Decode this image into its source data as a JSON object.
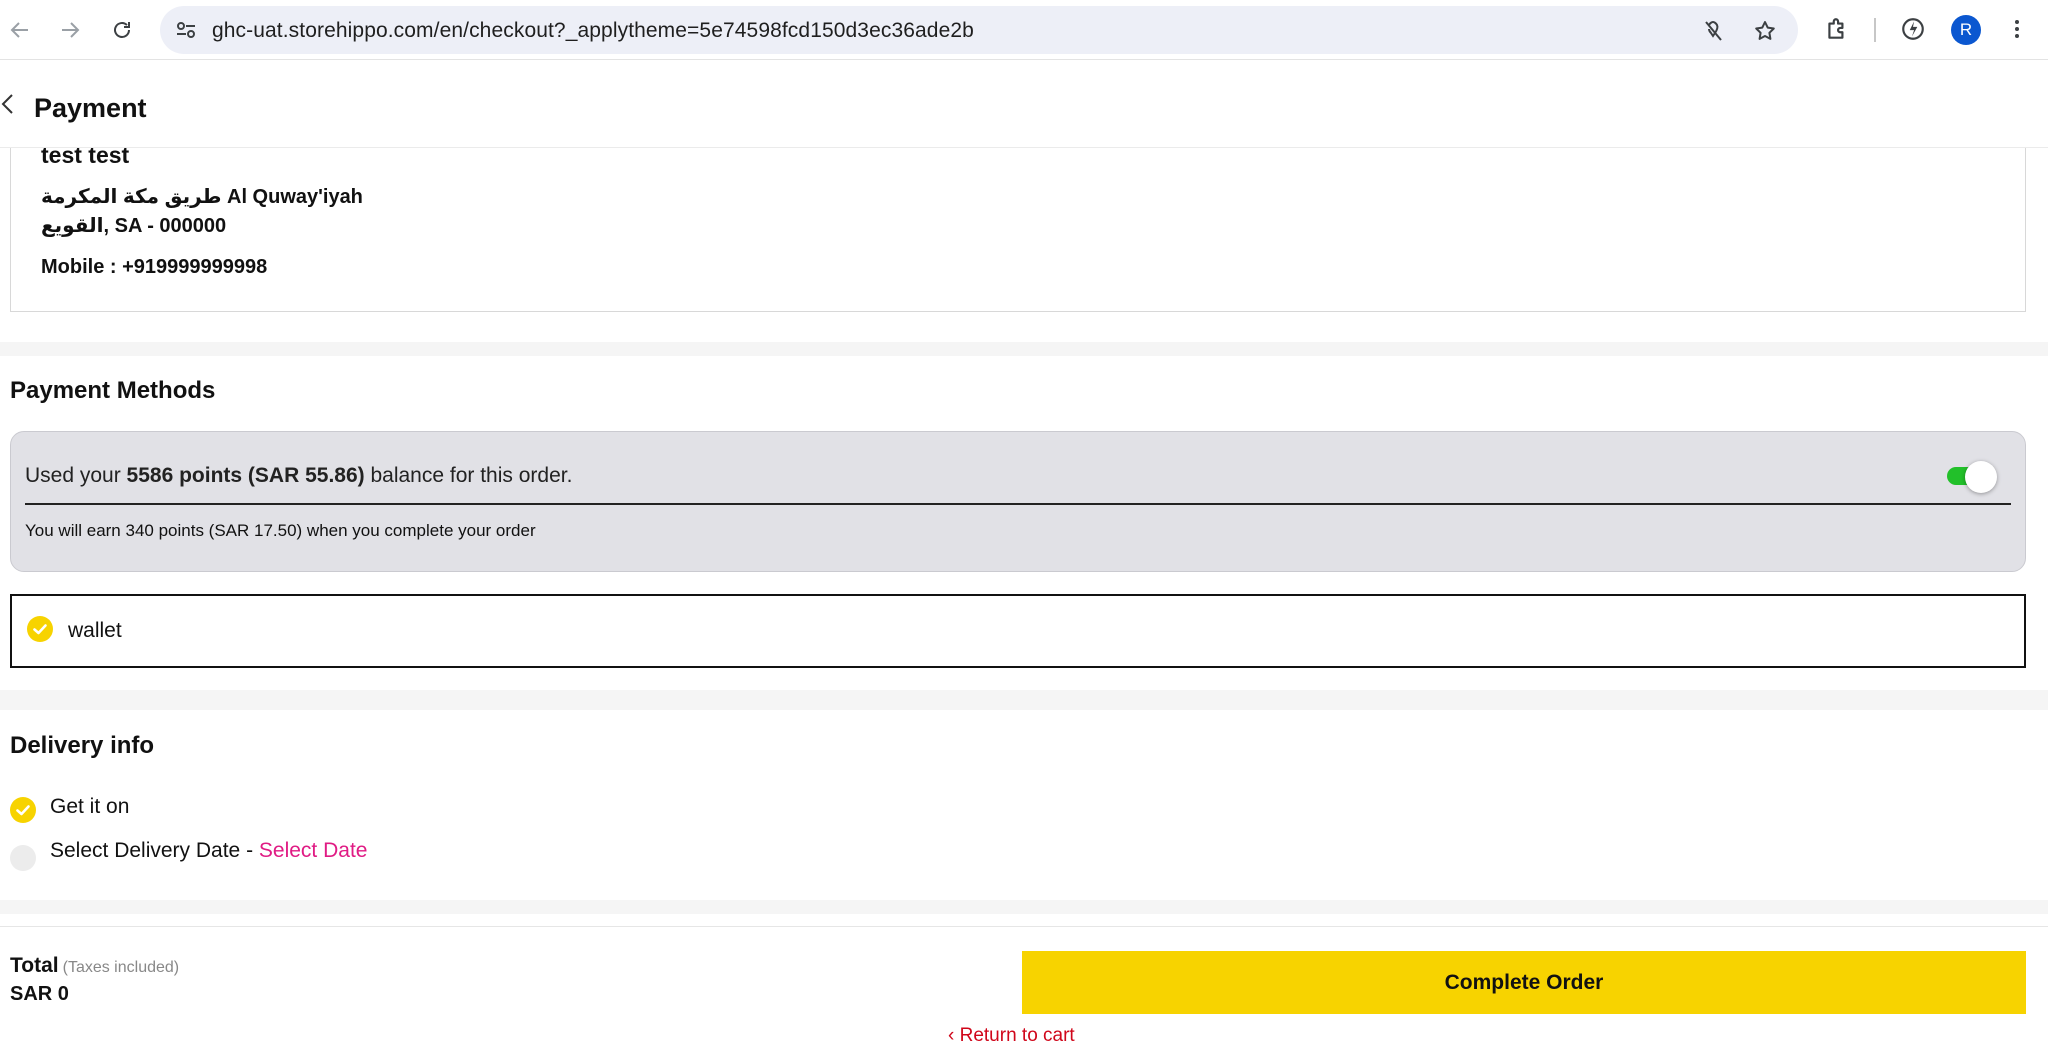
{
  "browser": {
    "url": "ghc-uat.storehippo.com/en/checkout?_applytheme=5e74598fcd150d3ec36ade2b",
    "profile_initial": "R",
    "icons": [
      "back-arrow-icon",
      "forward-arrow-icon",
      "reload-icon",
      "site-settings-icon",
      "tracking-protection-icon",
      "bookmark-star-icon",
      "extensions-icon",
      "performance-icon",
      "menu-dots-icon"
    ]
  },
  "header": {
    "title": "Payment"
  },
  "address": {
    "name": "test test",
    "line1": "طريق مكة المكرمة Al Quway'iyah",
    "line2": "القويع, SA - 000000",
    "mobile": "Mobile : +919999999998"
  },
  "payment_methods": {
    "title": "Payment Methods",
    "points_prefix": "Used your ",
    "points_bold": "5586 points (SAR 55.86)",
    "points_suffix": " balance for this order.",
    "toggle_on": true,
    "earn_text": "You will earn 340 points (SAR 17.50) when you complete your order",
    "method_label": "wallet"
  },
  "delivery": {
    "title": "Delivery info",
    "option1": "Get it on",
    "option2_prefix": "Select Delivery Date - ",
    "option2_link": "Select Date"
  },
  "footer": {
    "total_label": "Total",
    "tax_note": "(Taxes included)",
    "total_value": "SAR 0",
    "complete_button": "Complete Order",
    "return_link": "‹ Return to cart"
  },
  "colors": {
    "accent_yellow": "#f7d300",
    "toggle_green": "#22c02a",
    "link_pink": "#e01b84",
    "return_red": "#d0061a"
  }
}
